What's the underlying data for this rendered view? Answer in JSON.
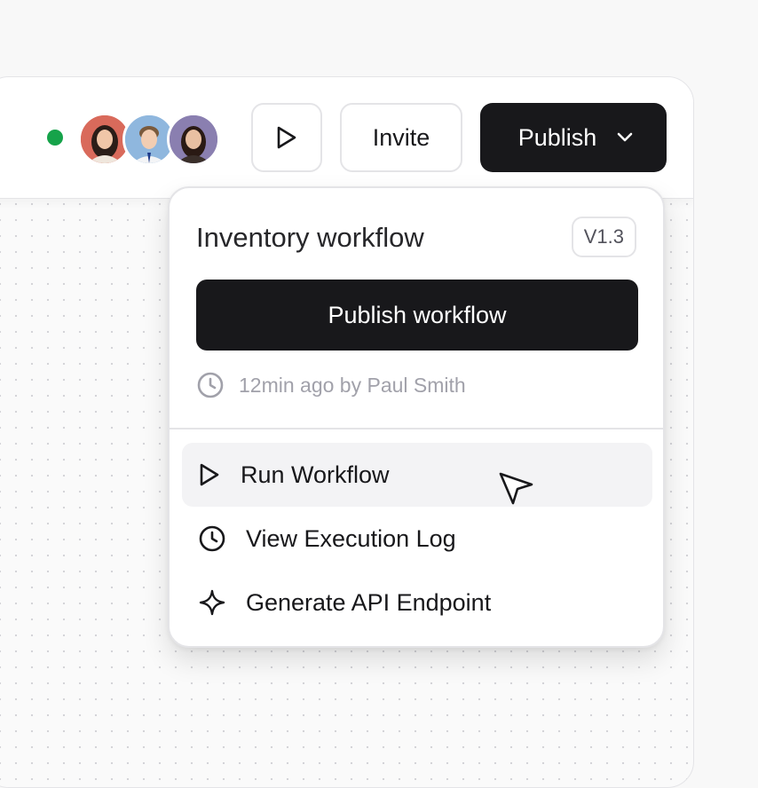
{
  "toolbar": {
    "status_color": "#16a34a",
    "avatars": [
      {
        "name": "avatar-1",
        "bg": "#d96a5b"
      },
      {
        "name": "avatar-2",
        "bg": "#8fb7de"
      },
      {
        "name": "avatar-3",
        "bg": "#8a7fb0"
      }
    ],
    "run_icon": "play-icon",
    "invite_label": "Invite",
    "publish_label": "Publish",
    "publish_icon": "chevron-down-icon"
  },
  "dropdown": {
    "title": "Inventory workflow",
    "version": "V1.3",
    "publish_button_label": "Publish workflow",
    "meta_icon": "clock-icon",
    "meta_text": "12min ago by Paul Smith",
    "items": [
      {
        "label": "Run Workflow",
        "icon": "play-icon",
        "active": true
      },
      {
        "label": "View Execution Log",
        "icon": "clock-icon",
        "active": false
      },
      {
        "label": "Generate API Endpoint",
        "icon": "sparkle-icon",
        "active": false
      }
    ]
  },
  "colors": {
    "primary_dark": "#18181b",
    "border": "#e4e4e7",
    "muted_text": "#a1a1aa"
  }
}
